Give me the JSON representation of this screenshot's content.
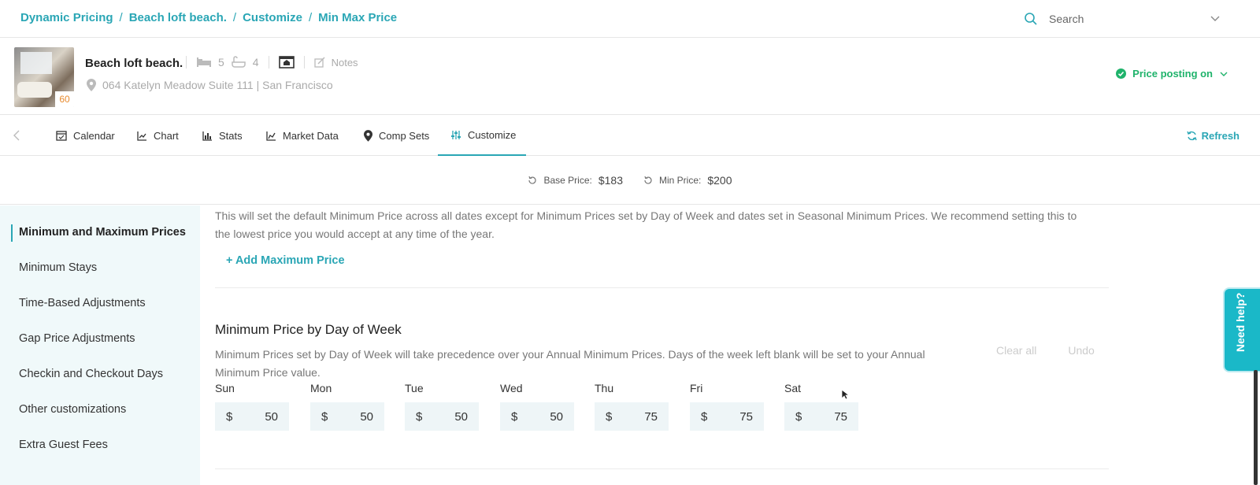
{
  "breadcrumb": [
    "Dynamic Pricing",
    "Beach loft beach.",
    "Customize",
    "Min Max Price"
  ],
  "search": {
    "label": "Search"
  },
  "listing": {
    "name": "Beach loft beach.",
    "badge": "60",
    "bedrooms": "5",
    "bathrooms": "4",
    "notes_label": "Notes",
    "address": "064 Katelyn Meadow Suite 111 | San Francisco"
  },
  "price_posting": {
    "label": "Price posting on"
  },
  "tabs": [
    {
      "label": "Calendar",
      "icon": "calendar-icon"
    },
    {
      "label": "Chart",
      "icon": "line-chart-icon"
    },
    {
      "label": "Stats",
      "icon": "bar-chart-icon"
    },
    {
      "label": "Market Data",
      "icon": "area-chart-icon"
    },
    {
      "label": "Comp Sets",
      "icon": "map-pin-icon"
    },
    {
      "label": "Customize",
      "icon": "sliders-icon"
    }
  ],
  "active_tab": "Customize",
  "refresh_label": "Refresh",
  "price_summary": {
    "base_label": "Base Price:",
    "base_value": "$183",
    "min_label": "Min Price:",
    "min_value": "$200"
  },
  "sidebar": {
    "items": [
      {
        "label": "Minimum and Maximum Prices"
      },
      {
        "label": "Minimum Stays"
      },
      {
        "label": "Time-Based Adjustments"
      },
      {
        "label": "Gap Price Adjustments"
      },
      {
        "label": "Checkin and Checkout Days"
      },
      {
        "label": "Other customizations"
      },
      {
        "label": "Extra Guest Fees"
      }
    ]
  },
  "content": {
    "annual_desc": "This will set the default Minimum Price across all dates except for Minimum Prices set by Day of Week and dates set in Seasonal Minimum Prices. We recommend setting this to the lowest price you would accept at any time of the year.",
    "add_max_label": "+ Add Maximum Price",
    "dow_title": "Minimum Price by Day of Week",
    "dow_desc": "Minimum Prices set by Day of Week will take precedence over your Annual Minimum Prices. Days of the week left blank will be set to your Annual Minimum Price value.",
    "clear_all": "Clear all",
    "undo": "Undo",
    "currency": "$",
    "days": [
      {
        "label": "Sun",
        "value": "50"
      },
      {
        "label": "Mon",
        "value": "50"
      },
      {
        "label": "Tue",
        "value": "50"
      },
      {
        "label": "Wed",
        "value": "50"
      },
      {
        "label": "Thu",
        "value": "75"
      },
      {
        "label": "Fri",
        "value": "75"
      },
      {
        "label": "Sat",
        "value": "75"
      }
    ]
  },
  "help": {
    "label": "Need help?"
  },
  "colors": {
    "accent": "#2aa6b5",
    "success": "#1fb36b",
    "help_bg": "#1ab8c8",
    "sidebar_bg": "#f0f9fa"
  }
}
